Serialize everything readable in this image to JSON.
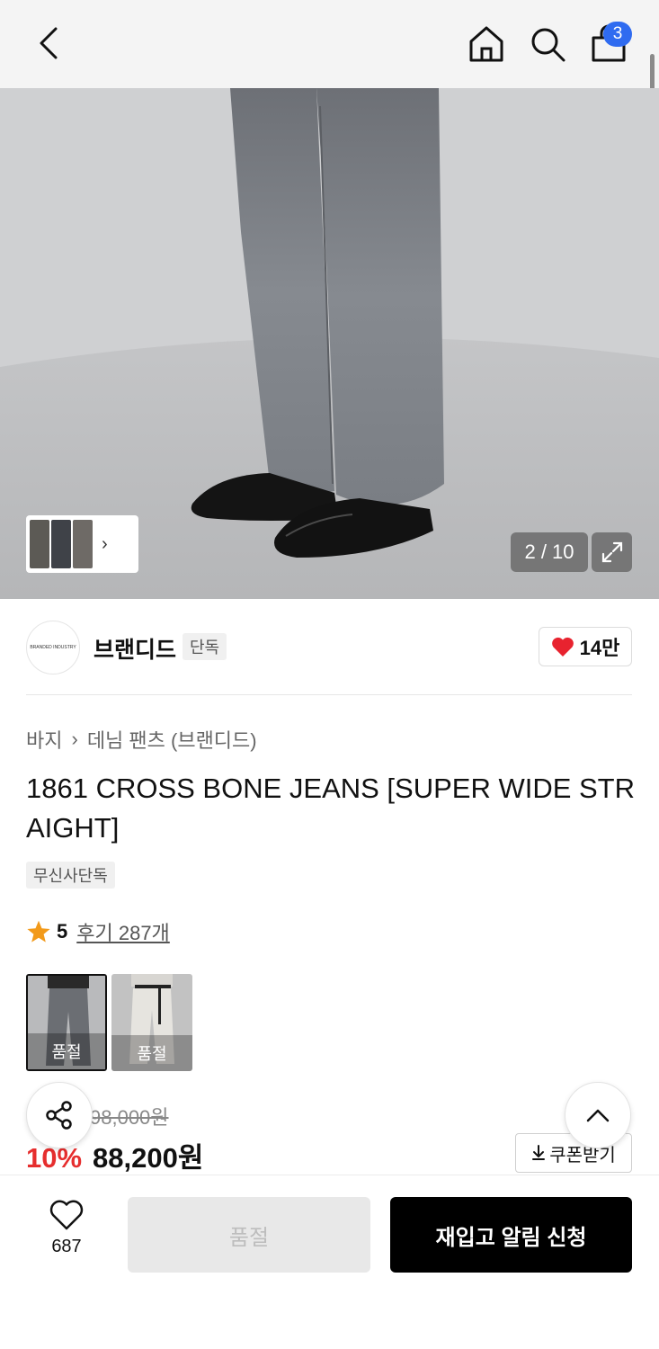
{
  "header": {
    "cart_count": "3"
  },
  "gallery": {
    "counter": "2 / 10"
  },
  "brand": {
    "logo_text": "BRANDED INDUSTRY",
    "name": "브랜디드",
    "tag": "단독",
    "likes": "14만"
  },
  "breadcrumb": {
    "category": "바지",
    "subcategory": "데님 팬츠 (브랜디드)"
  },
  "product": {
    "title": "1861 CROSS BONE JEANS [SUPER WIDE STRAIGHT]",
    "exclusive_tag": "무신사단독",
    "rating": "5",
    "reviews_label": "후기 287개",
    "variants": [
      {
        "label": "품절",
        "color": "#6b6e73"
      },
      {
        "label": "품절",
        "color": "#e6e4df"
      }
    ],
    "original_price": "98,000원",
    "discount": "10%",
    "sale_price": "88,200원",
    "coupon_label": "쿠폰받기"
  },
  "bottom_bar": {
    "wish_count": "687",
    "soldout_label": "품절",
    "restock_label": "재입고 알림 신청"
  },
  "colors": {
    "accent_blue": "#2f6bf0",
    "discount_red": "#e62e2e",
    "heart_red": "#e8232f",
    "star_orange": "#f29a1a"
  },
  "icons": [
    "back-icon",
    "home-icon",
    "search-icon",
    "shopping-bag-icon",
    "expand-icon",
    "heart-icon",
    "star-icon",
    "share-icon",
    "chevron-up-icon",
    "download-icon"
  ]
}
